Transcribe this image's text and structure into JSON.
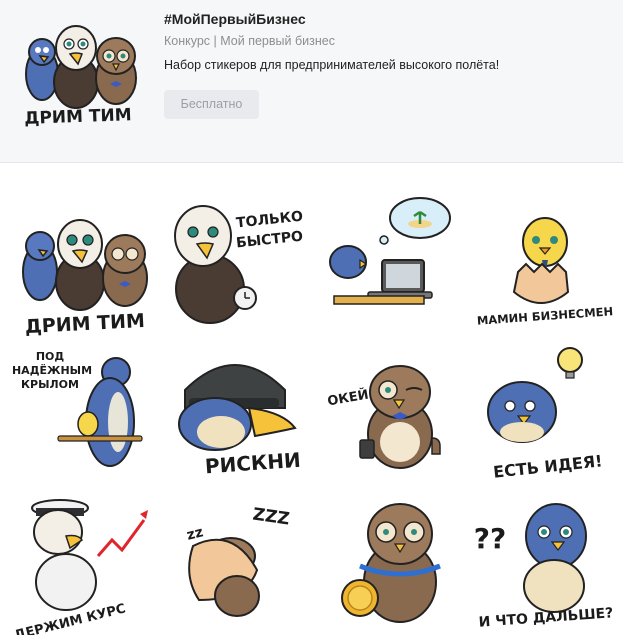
{
  "pack": {
    "title": "#МойПервыйБизнес",
    "subtitle": "Конкурс | Мой первый бизнес",
    "description": "Набор стикеров для предпринимателей высокого полёта!",
    "price_label": "Бесплатно"
  },
  "stickers": [
    {
      "id": "dream-team",
      "caption": "ДРИМ ТИМ"
    },
    {
      "id": "fast",
      "caption_line1": "ТОЛЬКО",
      "caption_line2": "БЫСТРО"
    },
    {
      "id": "dreaming-laptop",
      "caption": ""
    },
    {
      "id": "mama-businessman",
      "caption": "МАМИН БИЗНЕСМЕН"
    },
    {
      "id": "under-wing",
      "caption_line1": "ПОД",
      "caption_line2": "НАДЁЖНЫМ",
      "caption_line3": "КРЫЛОМ"
    },
    {
      "id": "risky",
      "caption": "РИСКНИ"
    },
    {
      "id": "okay",
      "caption": "ОКЕЙ"
    },
    {
      "id": "idea",
      "caption": "ЕСТЬ ИДЕЯ!"
    },
    {
      "id": "keep-course",
      "caption": "ДЕРЖИМ КУРС"
    },
    {
      "id": "sleep",
      "caption": "ZZZ"
    },
    {
      "id": "medal",
      "caption": ""
    },
    {
      "id": "whats-next",
      "caption": "И ЧТО ДАЛЬШЕ?",
      "marks": "??"
    }
  ]
}
